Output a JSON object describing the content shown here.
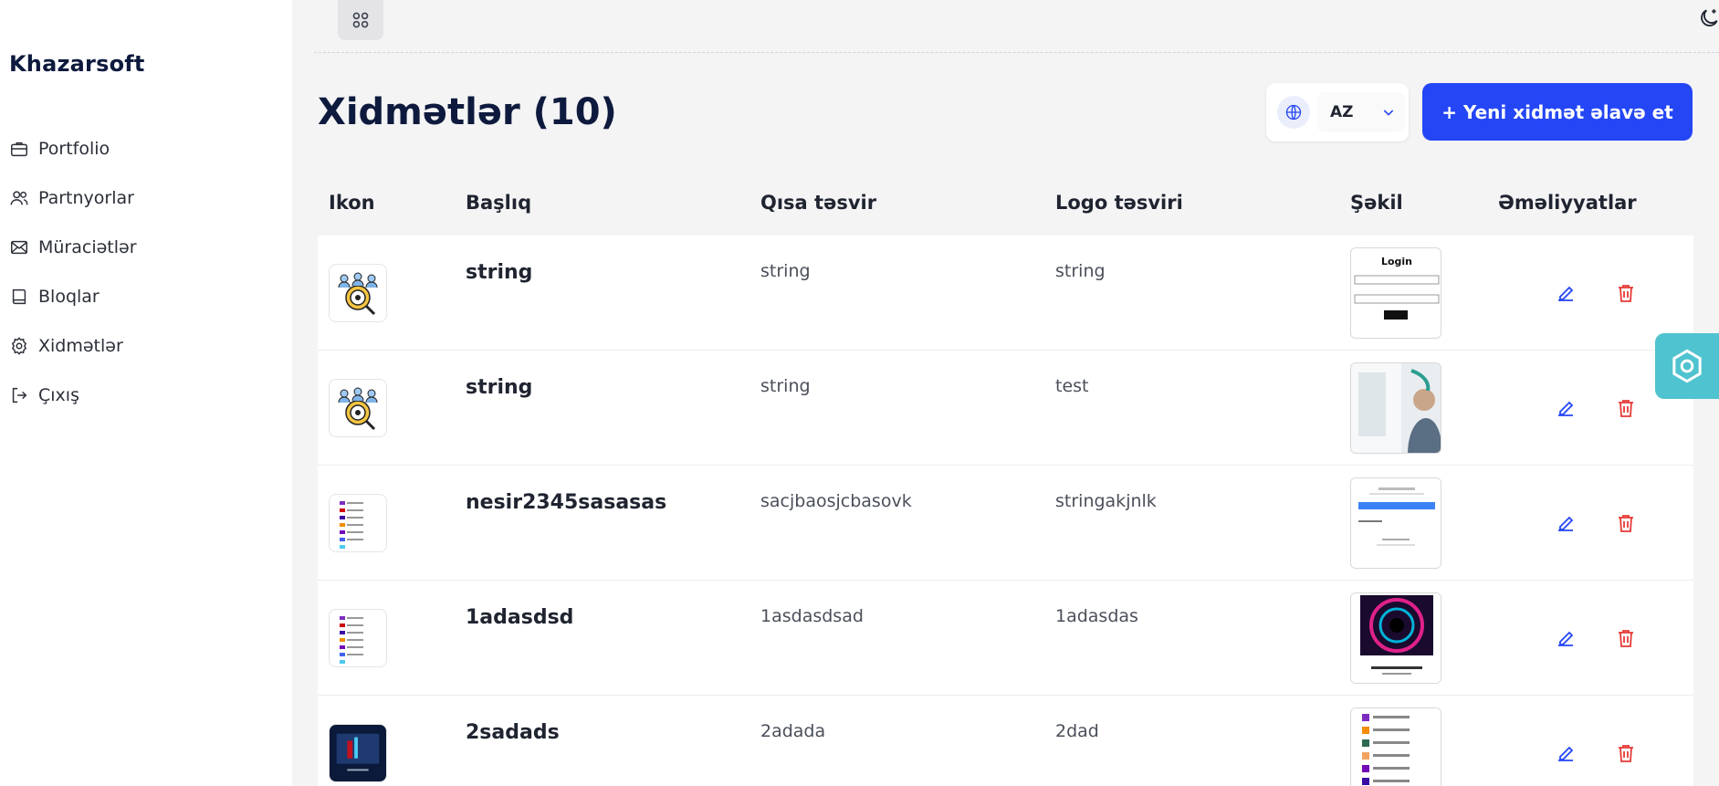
{
  "brand": "Khazarsoft",
  "sidebar": {
    "items": [
      {
        "label": "Portfolio",
        "icon": "briefcase-icon"
      },
      {
        "label": "Partnyorlar",
        "icon": "users-icon"
      },
      {
        "label": "Müraciətlər",
        "icon": "mail-icon"
      },
      {
        "label": "Bloqlar",
        "icon": "book-icon"
      },
      {
        "label": "Xidmətlər",
        "icon": "gear-icon"
      },
      {
        "label": "Çıxış",
        "icon": "logout-icon"
      }
    ]
  },
  "page": {
    "title": "Xidmətlər (10)",
    "language": "AZ",
    "add_button": "+ Yeni xidmət əlavə et"
  },
  "table": {
    "headers": [
      "Ikon",
      "Başlıq",
      "Qısa təsvir",
      "Logo təsviri",
      "Şəkil",
      "Əməliyyatlar"
    ],
    "rows": [
      {
        "title": "string",
        "short_desc": "string",
        "logo_desc": "string",
        "icon": "people-gear-icon",
        "image": "login-screenshot"
      },
      {
        "title": "string",
        "short_desc": "string",
        "logo_desc": "test",
        "icon": "people-gear-icon",
        "image": "office-photo"
      },
      {
        "title": "nesir2345sasasas",
        "short_desc": "sacjbaosjcbasovk",
        "logo_desc": "stringakjnlk",
        "icon": "list-screenshot",
        "image": "upload-screenshot"
      },
      {
        "title": "1adasdsd",
        "short_desc": "1asdasdsad",
        "logo_desc": "1adasdas",
        "icon": "list-screenshot",
        "image": "vortex-screenshot"
      },
      {
        "title": "2sadads",
        "short_desc": "2adada",
        "logo_desc": "2dad",
        "icon": "dark-screenshot",
        "image": "list-screenshot"
      }
    ]
  },
  "colors": {
    "accent": "#2446f5",
    "delete": "#e53935",
    "edit": "#2446f5",
    "float": "#4fc3cf",
    "title": "#0e1a3d"
  }
}
